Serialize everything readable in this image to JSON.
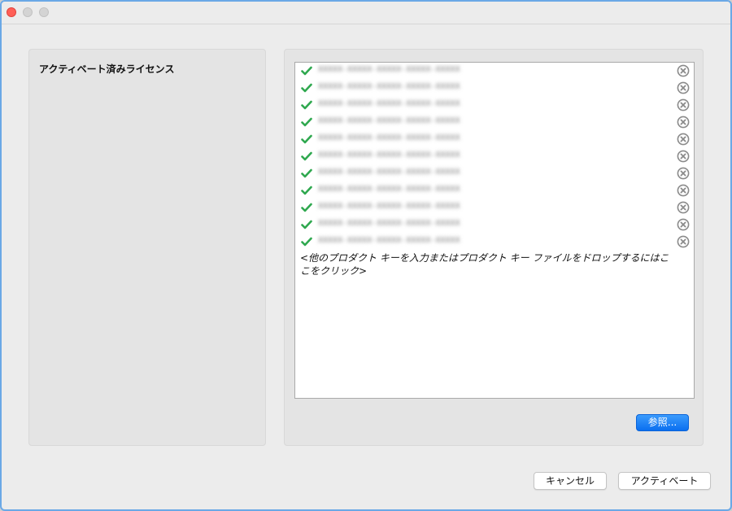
{
  "left_panel": {
    "title": "アクティベート済みライセンス"
  },
  "key_list": {
    "items": [
      {
        "key": "XXXXX-XXXXX-XXXXX-XXXXX-XXXXX",
        "status": "activated"
      },
      {
        "key": "XXXXX-XXXXX-XXXXX-XXXXX-XXXXX",
        "status": "activated"
      },
      {
        "key": "XXXXX-XXXXX-XXXXX-XXXXX-XXXXX",
        "status": "activated"
      },
      {
        "key": "XXXXX-XXXXX-XXXXX-XXXXX-XXXXX",
        "status": "activated"
      },
      {
        "key": "XXXXX-XXXXX-XXXXX-XXXXX-XXXXX",
        "status": "activated"
      },
      {
        "key": "XXXXX-XXXXX-XXXXX-XXXXX-XXXXX",
        "status": "activated"
      },
      {
        "key": "XXXXX-XXXXX-XXXXX-XXXXX-XXXXX",
        "status": "activated"
      },
      {
        "key": "XXXXX-XXXXX-XXXXX-XXXXX-XXXXX",
        "status": "activated"
      },
      {
        "key": "XXXXX-XXXXX-XXXXX-XXXXX-XXXXX",
        "status": "activated"
      },
      {
        "key": "XXXXX-XXXXX-XXXXX-XXXXX-XXXXX",
        "status": "activated"
      },
      {
        "key": "XXXXX-XXXXX-XXXXX-XXXXX-XXXXX",
        "status": "activated"
      }
    ],
    "placeholder": "<他のプロダクト キーを入力またはプロダクト キー ファイルをドロップするにはここをクリック>"
  },
  "buttons": {
    "browse": "参照...",
    "cancel": "キャンセル",
    "activate": "アクティベート"
  },
  "colors": {
    "check": "#2fa84f",
    "remove": "#8a8a8a",
    "accent": "#0a6ff0"
  },
  "icons": {
    "check": "checkmark-icon",
    "remove": "remove-circle-icon"
  }
}
